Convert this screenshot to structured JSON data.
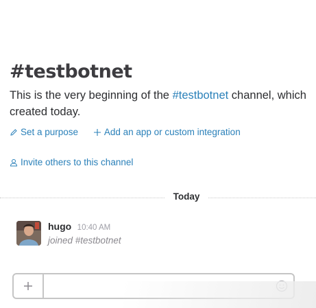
{
  "channel": {
    "title": "#testbotnet",
    "intro_prefix": "This is the very beginning of the ",
    "intro_link": "#testbotnet",
    "intro_suffix": " channel, which",
    "intro_line2": "created today."
  },
  "actions": {
    "set_purpose": "Set a purpose",
    "add_app": "Add an app or custom integration",
    "invite": "Invite others to this channel"
  },
  "divider": {
    "label": "Today"
  },
  "messages": [
    {
      "sender": "hugo",
      "time": "10:40 AM",
      "text": "joined #testbotnet"
    }
  ],
  "composer": {
    "value": "",
    "placeholder": ""
  },
  "icons": {
    "set_purpose": "pencil-icon",
    "add_app": "plus-icon",
    "invite": "user-icon",
    "composer_attach": "plus-icon",
    "composer_emoji": "smiley-icon"
  },
  "colors": {
    "link": "#2a80b9",
    "text": "#2c2d30",
    "muted": "#9e9ea6"
  }
}
